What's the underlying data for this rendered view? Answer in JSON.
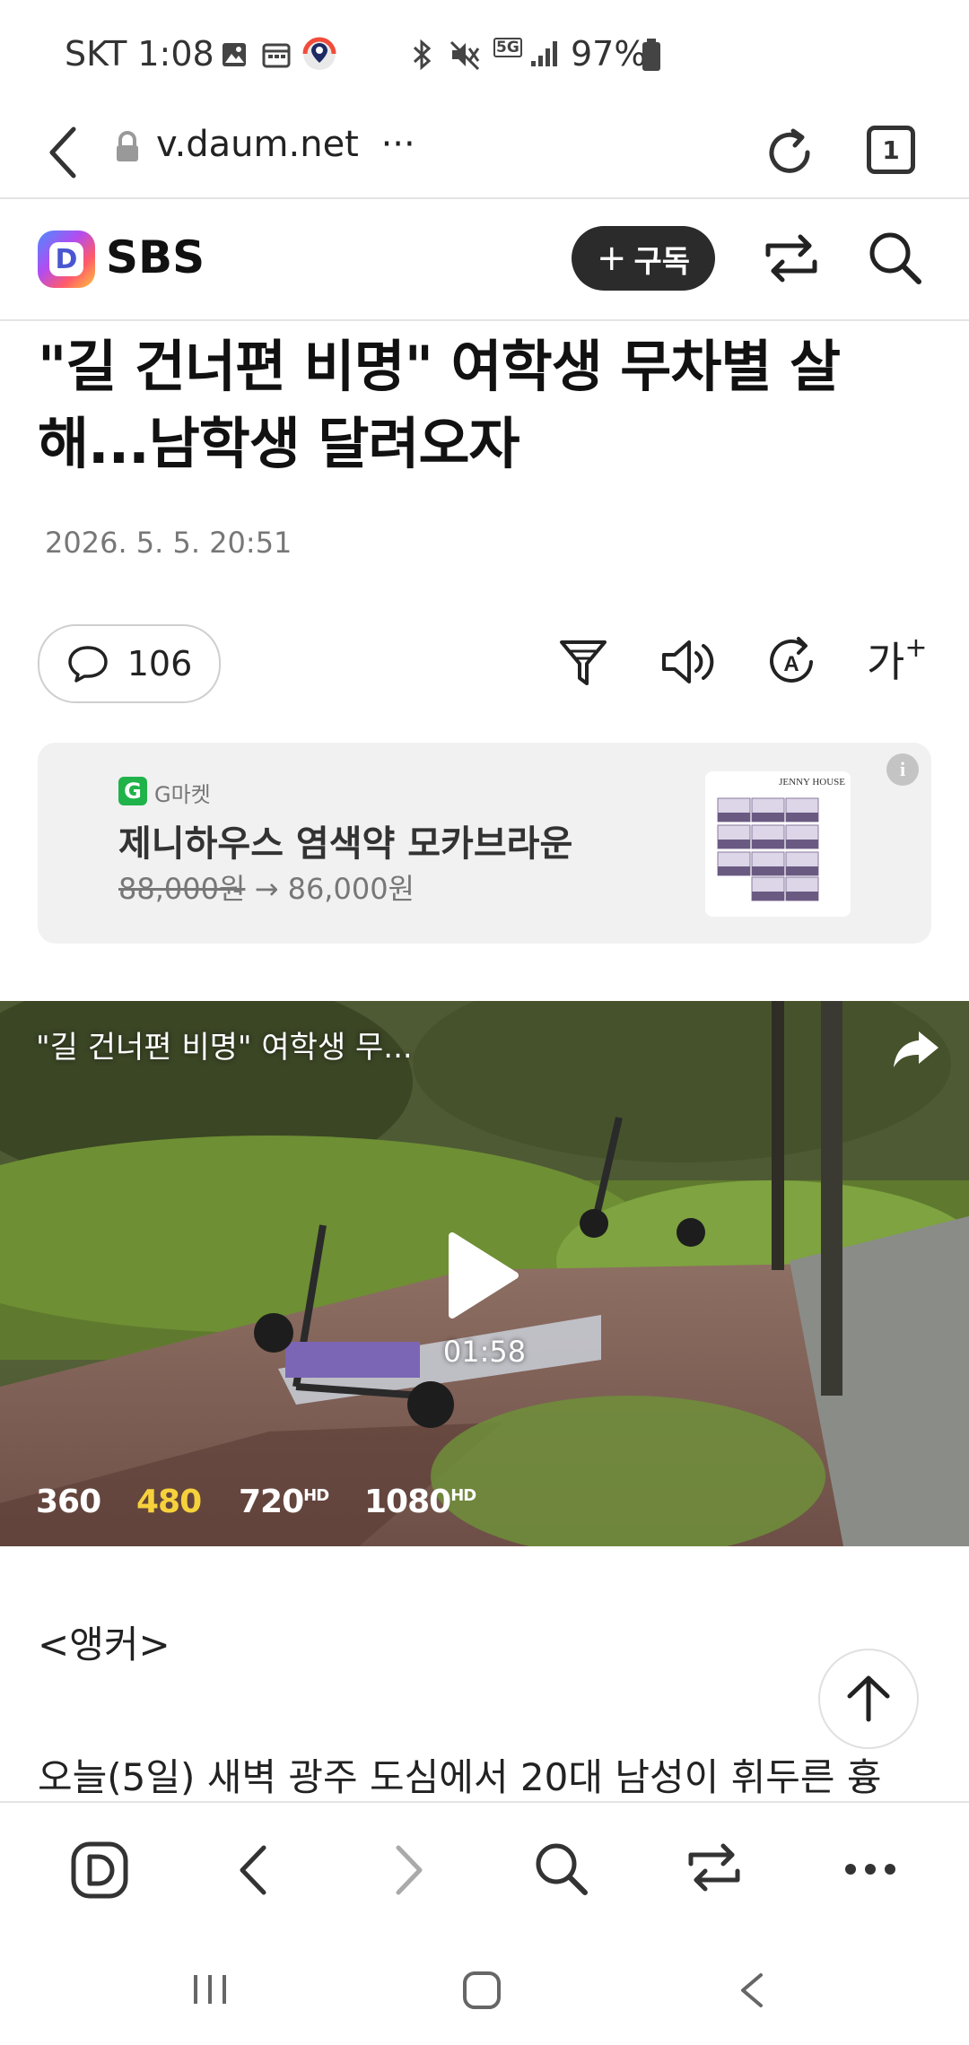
{
  "status_bar": {
    "carrier_time": "SKT 1:08",
    "battery": "97%",
    "network": "5G"
  },
  "browser": {
    "url": "v.daum.net",
    "url_more": "···",
    "tab_count": "1"
  },
  "header": {
    "logo_letter": "D",
    "publisher": "SBS",
    "subscribe_label": "구독",
    "subscribe_plus": "+"
  },
  "article": {
    "title_line1": "\"길 건너편 비명\" 여학생 무차별 살",
    "title_line2": "해...남학생 달려오자",
    "date": "2026. 5. 5. 20:51",
    "comment_count": "106",
    "font_size_label": "가",
    "font_size_plus": "+"
  },
  "ad": {
    "brand_letter": "G",
    "brand": "G마켓",
    "product": "제니하우스 염색약 모카브라운",
    "original_price": "88,000원",
    "arrow": "→",
    "sale_price": "86,000원",
    "product_image_text": "JENNY HOUSE",
    "info": "i"
  },
  "video": {
    "title": "\"길 건너편 비명\" 여학생 무...",
    "duration": "01:58",
    "qualities": [
      {
        "label": "360",
        "hd": "",
        "selected": false
      },
      {
        "label": "480",
        "hd": "",
        "selected": true
      },
      {
        "label": "720",
        "hd": "HD",
        "selected": false
      },
      {
        "label": "1080",
        "hd": "HD",
        "selected": false
      }
    ]
  },
  "body": {
    "anchor": "<앵커>",
    "first_line": "오늘(5일) 새벽 광주 도심에서 20대 남성이 휘두른 흉"
  },
  "colors": {
    "accent_yellow": "#f7d13b",
    "subscribe_bg": "#2b2b2b",
    "ad_bg": "#f1f1f1"
  },
  "icons": {
    "bottom_nav": [
      "daum-home-icon",
      "back-icon",
      "forward-icon",
      "search-icon",
      "share-icon",
      "more-icon"
    ]
  }
}
